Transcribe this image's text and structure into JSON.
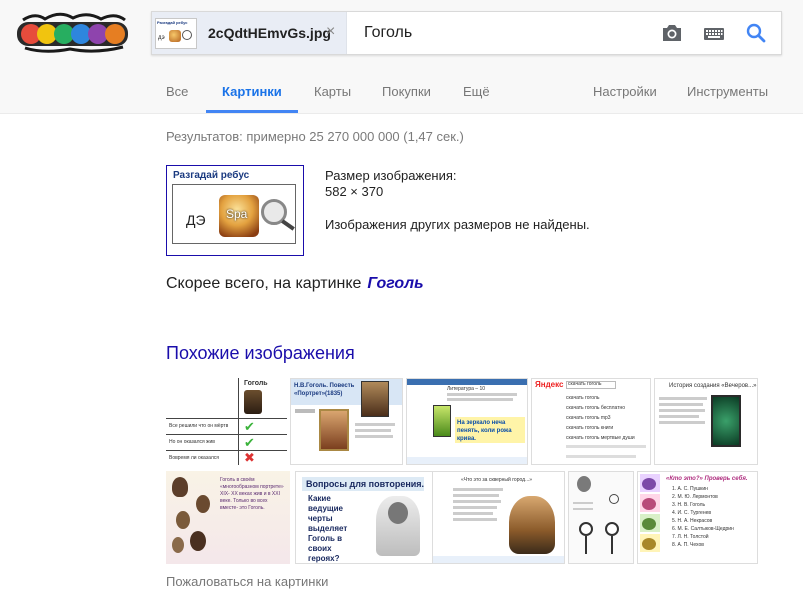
{
  "search": {
    "chip_thumb_title": "Разгадай ребус",
    "chip_thumb_text": "дэ",
    "filename": "2cQdtHEmvGs.jpg",
    "query": "Гоголь"
  },
  "tabs": [
    {
      "label": "Все"
    },
    {
      "label": "Картинки"
    },
    {
      "label": "Карты"
    },
    {
      "label": "Покупки"
    },
    {
      "label": "Ещё"
    },
    {
      "label": "Настройки"
    },
    {
      "label": "Инструменты"
    }
  ],
  "results": {
    "stats": "Результатов: примерно 25 270 000 000 (1,47 сек.)",
    "thumb_title": "Разгадай ребус",
    "thumb_text": "ДЭ",
    "thumb_spa": "Spa",
    "size_label": "Размер изображения:",
    "size_value": "582 × 370",
    "no_other_sizes": "Изображения других размеров не найдены.",
    "best_guess_prefix": "Скорее всего, на картинке",
    "best_guess_term": "Гоголь"
  },
  "similar": {
    "title": "Похожие изображения",
    "images": [
      {
        "header": "Гоголь",
        "rows": [
          "Все решили что он мёртв",
          "Но он оказался жив",
          "Вовремя ли оказался"
        ]
      },
      {
        "title": "Н.В.Гоголь. Повесть «Портрет»(1835)"
      },
      {
        "label": "Литература – 10",
        "text": "На зеркало неча пенять, коли рожа крива."
      },
      {
        "brand": "Яндекс",
        "query": "скачать гоголь",
        "lines": [
          "скачать гоголь",
          "скачать гоголь бесплатно",
          "скачать гоголь mp3",
          "скачать гоголь книги",
          "скачать гоголь мертвые души"
        ]
      },
      {
        "title": "История создания «Вечеров...»"
      },
      {
        "text": "Гоголь в своём «многообразном портрете» XIX- XX веках жив и в XXI веке. Только во всех вместе- это Гоголь."
      },
      {
        "title": "Вопросы для повторения.",
        "bullet": "Какие ведущие черты выделяет Гоголь в своих героях?"
      },
      {
        "text": "«Что это за скверный город...»"
      },
      {},
      {
        "title": "«Кто это?» Проверь себя.",
        "items": [
          "1. А. С. Пушкин",
          "2. М. Ю. Лермонтов",
          "3. Н. В. Гоголь",
          "4. И. С. Тургенев",
          "5. Н. А. Некрасов",
          "6. М. Е. Салтыков-Щедрин",
          "7. Л. Н. Толстой",
          "8. А. П. Чехов"
        ]
      }
    ]
  },
  "footer": {
    "report": "Пожаловаться на картинки"
  },
  "colors": {
    "link": "#1a0dab",
    "tab_active": "#1a73e8",
    "underline": "#4285f4"
  }
}
